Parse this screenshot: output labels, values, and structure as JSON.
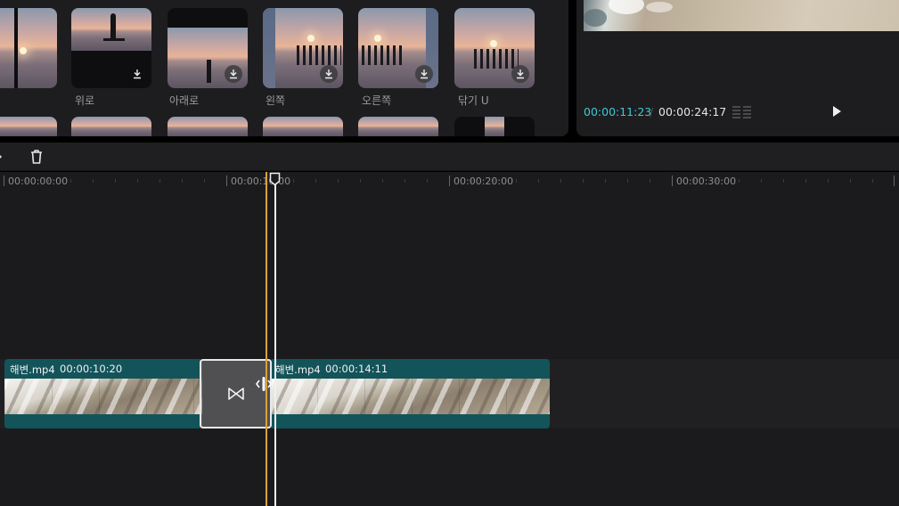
{
  "media_panel": {
    "thumbnails": [
      {
        "label": ""
      },
      {
        "label": "위로"
      },
      {
        "label": "아래로"
      },
      {
        "label": "왼쪽"
      },
      {
        "label": "오른쪽"
      },
      {
        "label": "닦기 U"
      }
    ]
  },
  "preview": {
    "current_time": "00:00:11:23",
    "separator": "/",
    "total_time": "00:00:24:17"
  },
  "timeline": {
    "ruler": [
      "00:00:00:00",
      "00:00:10:00",
      "00:00:20:00",
      "00:00:30:00"
    ],
    "clips": [
      {
        "name": "해변.mp4",
        "duration": "00:00:10:20"
      },
      {
        "name": "해변.mp4",
        "duration": "00:00:14:11"
      }
    ]
  },
  "colors": {
    "accent_timecode": "#3fc9d8",
    "clip_bg": "#13545a",
    "marker": "#d7a23a"
  },
  "icons": [
    "download-icon",
    "grid-icon",
    "play-icon",
    "split-icon",
    "delete-icon",
    "transition-icon",
    "trim-handle-icon",
    "playhead-icon"
  ]
}
